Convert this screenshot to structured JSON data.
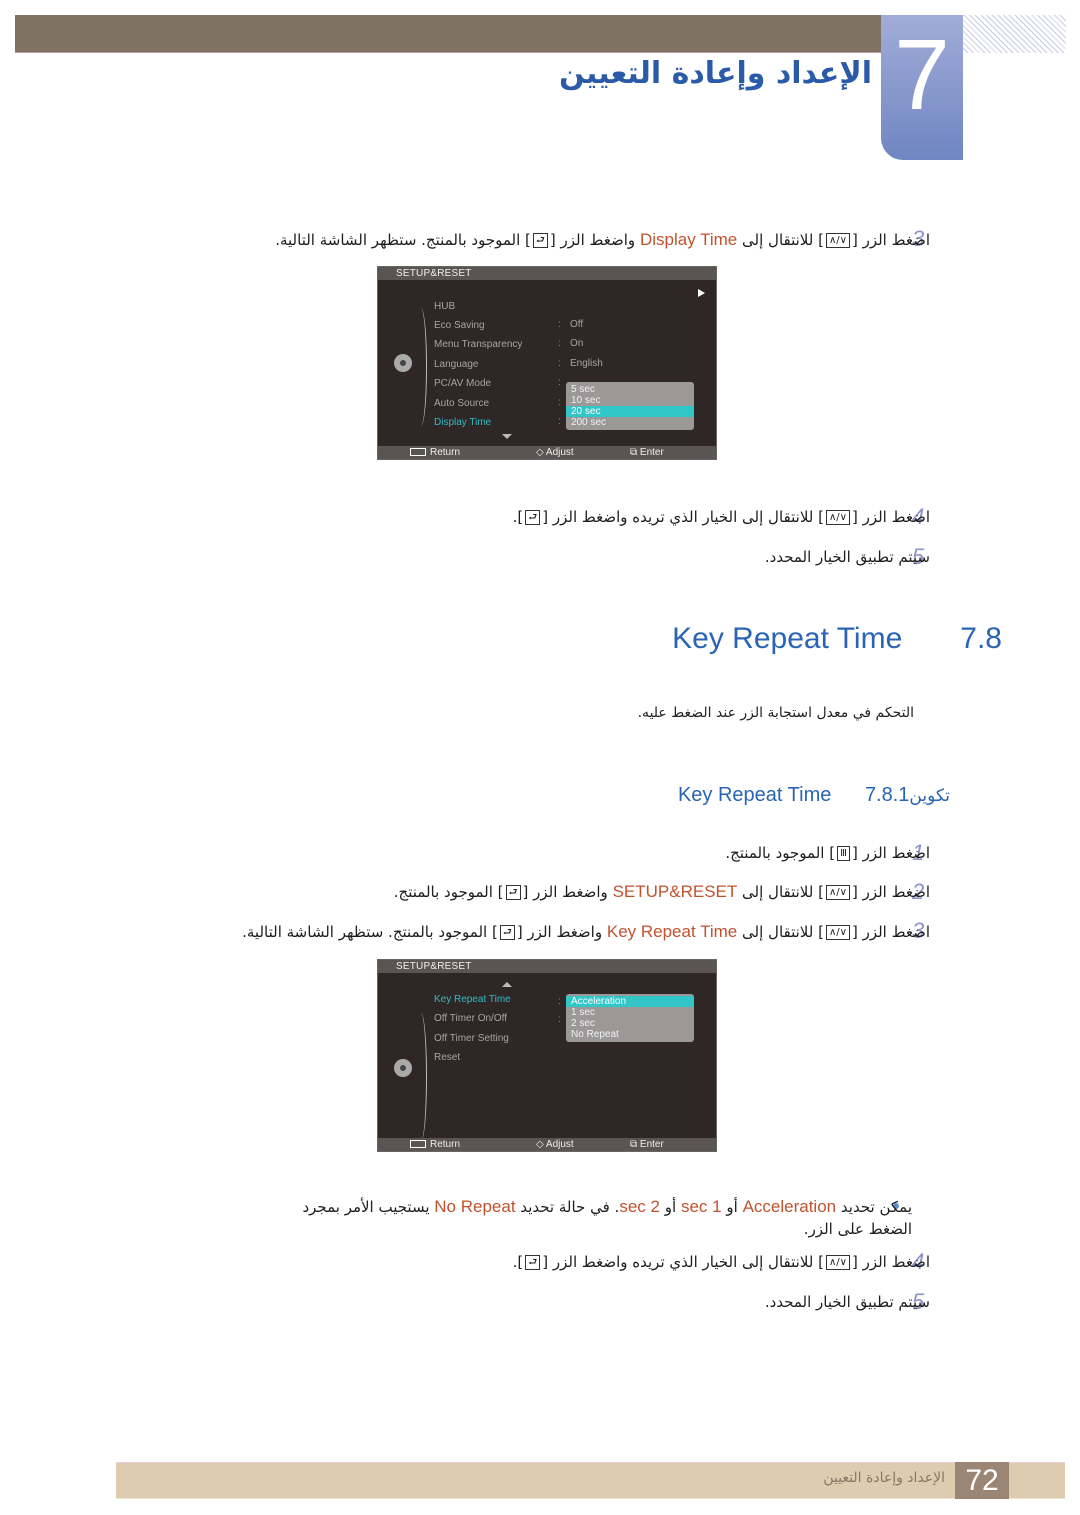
{
  "header": {
    "chapter_number": "7",
    "chapter_title": "الإعداد وإعادة التعيين"
  },
  "display_time_steps": [
    {
      "num": "3",
      "pre": "اضغط الزر [",
      "nav": "∧/∨",
      "mid": "] للانتقال إلى ",
      "highlight": "Display Time",
      "post": " واضغط الزر [",
      "btn": "⮐",
      "tail": "] الموجود بالمنتج. ستظهر الشاشة التالية."
    },
    {
      "num": "4",
      "pre": "اضغط الزر [",
      "nav": "∧/∨",
      "mid": "] للانتقال إلى الخيار الذي تريده واضغط الزر [",
      "btn": "⮐",
      "tail": "]."
    },
    {
      "num": "5",
      "text": "سيتم تطبيق الخيار المحدد."
    }
  ],
  "osd1": {
    "title": "SETUP&RESET",
    "items": [
      {
        "label": "HUB",
        "value": ""
      },
      {
        "label": "Eco Saving",
        "value": "Off"
      },
      {
        "label": "Menu Transparency",
        "value": "On"
      },
      {
        "label": "Language",
        "value": "English"
      },
      {
        "label": "PC/AV Mode",
        "value": ""
      },
      {
        "label": "Auto Source",
        "value": ""
      },
      {
        "label": "Display Time",
        "value": ""
      }
    ],
    "active_item": "Display Time",
    "dropdown": [
      "5 sec",
      "10 sec",
      "20 sec",
      "200 sec"
    ],
    "dropdown_selected": "20 sec",
    "footer": {
      "return": "Return",
      "adjust": "Adjust",
      "enter": "Enter"
    }
  },
  "section": {
    "number": "7.8",
    "title": "Key Repeat Time",
    "description": "التحكم في معدل استجابة الزر عند الضغط عليه."
  },
  "subsection": {
    "number": "7.8.1",
    "title_ar": "تكوين",
    "title_en": "Key Repeat Time"
  },
  "key_repeat_steps": [
    {
      "num": "1",
      "pre": "اضغط الزر [",
      "btn": "Ⅲ",
      "tail": "] الموجود بالمنتج."
    },
    {
      "num": "2",
      "pre": "اضغط الزر [",
      "nav": "∧/∨",
      "mid": "] للانتقال إلى ",
      "highlight": "SETUP&RESET",
      "post": " واضغط الزر [",
      "btn": "⮐",
      "tail": "] الموجود بالمنتج."
    },
    {
      "num": "3",
      "pre": "اضغط الزر [",
      "nav": "∧/∨",
      "mid": "] للانتقال إلى ",
      "highlight": "Key Repeat Time",
      "post": " واضغط الزر [",
      "btn": "⮐",
      "tail": "] الموجود بالمنتج. ستظهر الشاشة التالية."
    },
    {
      "num": "4",
      "pre": "اضغط الزر [",
      "nav": "∧/∨",
      "mid": "] للانتقال إلى الخيار الذي تريده واضغط الزر [",
      "btn": "⮐",
      "tail": "]."
    },
    {
      "num": "5",
      "text": "سيتم تطبيق الخيار المحدد."
    }
  ],
  "osd2": {
    "title": "SETUP&RESET",
    "items": [
      {
        "label": "Key Repeat Time"
      },
      {
        "label": "Off Timer On/Off"
      },
      {
        "label": "Off Timer Setting"
      },
      {
        "label": "Reset"
      }
    ],
    "active_item": "Key Repeat Time",
    "dropdown": [
      "Acceleration",
      "1 sec",
      "2 sec",
      "No Repeat"
    ],
    "dropdown_selected": "Acceleration",
    "footer": {
      "return": "Return",
      "adjust": "Adjust",
      "enter": "Enter"
    }
  },
  "note": {
    "t1": "يمكن تحديد ",
    "h1": "Acceleration",
    "t2": " أو ",
    "h2": "1 sec",
    "t3": " أو ",
    "h3": "2 sec",
    "t4": ". في حالة تحديد ",
    "h4": "No Repeat",
    "t5": " يستجيب الأمر بمجرد الضغط على الزر."
  },
  "footer": {
    "page_number": "72",
    "chapter_title": "الإعداد وإعادة التعيين"
  },
  "colors": {
    "heading_blue": "#2a64b4",
    "highlight_orange": "#c0532f",
    "osd_selected": "#33c6c9",
    "step_number": "#8b92cc"
  }
}
